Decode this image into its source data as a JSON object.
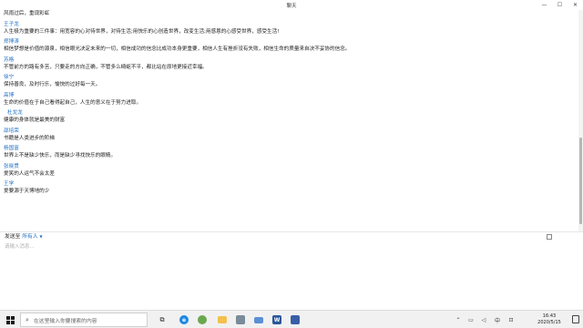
{
  "window": {
    "title": "聊天",
    "controls": {
      "minimize": "—",
      "maximize": "☐",
      "close": "✕"
    }
  },
  "chat": {
    "first_line": "风雨过后，重现彩虹",
    "messages": [
      {
        "sender": "王子龙",
        "text": "人生极为重要的三件事：用宽容的心对待世界，对待生活;用快乐的心创造世界，改变生活;用感恩的心感受世界，感受生活!"
      },
      {
        "sender": "郑博涛",
        "text": "相信梦想是价值的源泉，相信眼光决定未来的一切，相信成功的信念比成功本身更重要，相信人生有挫折没有失败，相信生命的质量来自决不妥协的信念。"
      },
      {
        "sender": "苏格",
        "text": "不管前方的路有多苦，只要走的方向正确，不管多么崎岖不平，都比站在原地更接近幸福。"
      },
      {
        "sender": "徐宁",
        "text": "保持善良，及时行乐，愉快的过好每一天。"
      },
      {
        "sender": "高博",
        "text": "生命的价值在于自己看得起自己，人生的意义在于努力进取。"
      },
      {
        "sender": "杜龙龙",
        "text": "健康的身体就是最美的财富"
      },
      {
        "sender": "邵培荣",
        "text": "书籍是人类进步的阶梯"
      },
      {
        "sender": "杨国富",
        "text": "世界上不是缺少快乐，而是缺少寻找快乐的眼睛。"
      },
      {
        "sender": "张晓贯",
        "text": "爱笑的人运气不会太差"
      },
      {
        "sender": "王学",
        "text": "爱要源于天博地的少"
      }
    ]
  },
  "composer": {
    "send_to_label": "发送至",
    "recipient": "所有人",
    "caret": "▼",
    "placeholder": "请输入消息..."
  },
  "taskbar": {
    "search_placeholder": "在这里输入你要搜索的内容",
    "time": "16:43",
    "date": "2020/5/15",
    "ime": "中",
    "apps": [
      "task-view",
      "edge",
      "green-app",
      "folder",
      "image-viewer",
      "mail",
      "word",
      "video-app"
    ]
  },
  "colors": {
    "sender": "#1f6fc4",
    "edge": "#1e88e5",
    "word": "#2b579a",
    "green_app": "#6aa84f"
  }
}
